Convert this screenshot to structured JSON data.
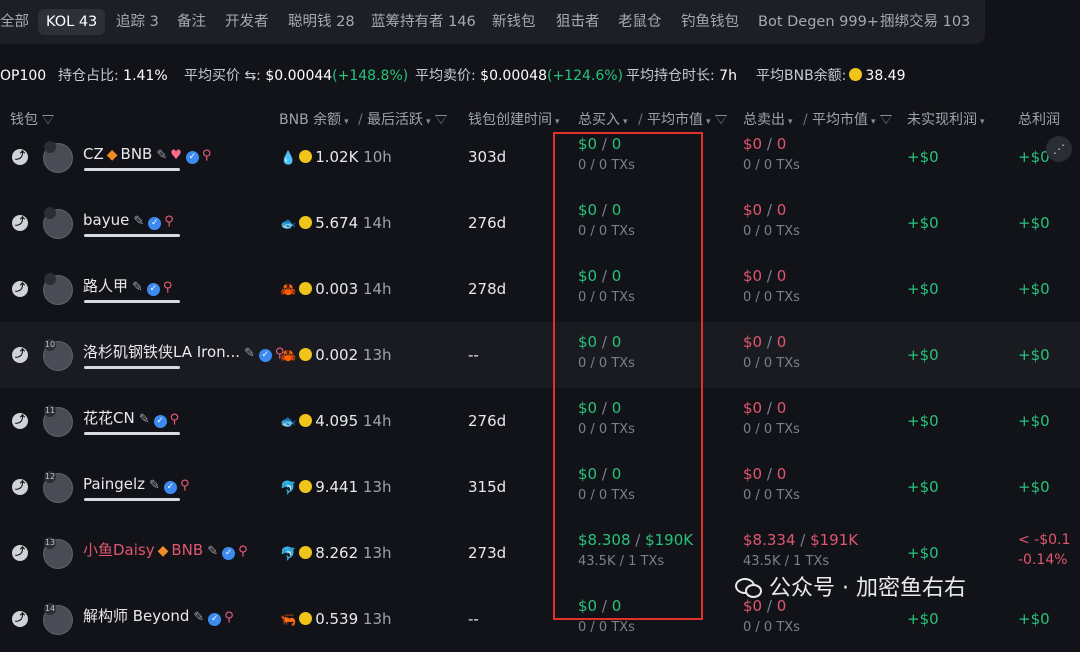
{
  "tabs": [
    {
      "label": "全部"
    },
    {
      "label": "KOL 43",
      "active": true
    },
    {
      "label": "追踪 3"
    },
    {
      "label": "备注"
    },
    {
      "label": "开发者"
    },
    {
      "label": "聪明钱 28"
    },
    {
      "label": "蓝筹持有者 146"
    },
    {
      "label": "新钱包"
    },
    {
      "label": "狙击者"
    },
    {
      "label": "老鼠仓"
    },
    {
      "label": "钓鱼钱包"
    },
    {
      "label": "Bot Degen 999+"
    },
    {
      "label": "捆绑交易 103"
    }
  ],
  "stats": {
    "top_label": "OP100",
    "hold_ratio_label": "持仓占比:",
    "hold_ratio_value": "1.41%",
    "avg_buy_label": "平均买价 ⇆:",
    "avg_buy_value": "$0.00044",
    "avg_buy_change": "(+148.8%)",
    "avg_sell_label": "平均卖价:",
    "avg_sell_value": "$0.00048",
    "avg_sell_change": "(+124.6%)",
    "avg_hold_label": "平均持仓时长:",
    "avg_hold_value": "7h",
    "avg_bnb_label": "平均BNB余额:",
    "avg_bnb_value": "38.49"
  },
  "columns": {
    "wallet": "钱包",
    "bnb_balance": "BNB 余额",
    "last_active": "最后活跃",
    "wallet_created": "钱包创建时间",
    "total_buy": "总买入",
    "avg_mcap_buy": "平均市值",
    "total_sell": "总卖出",
    "avg_mcap_sell": "平均市值",
    "unrealized": "未实现利润",
    "total_profit": "总利润"
  },
  "rows": [
    {
      "rank": "",
      "name": "CZ",
      "suffix": "BNB",
      "diamond": true,
      "heart": true,
      "underline": true,
      "red_name": false,
      "tag_icon": "water-drop",
      "bnb": "1.02K",
      "active": "10h",
      "created": "303d",
      "buy_amount": "$0",
      "buy_mcap": "0",
      "buy_sub": "0 / 0 TXs",
      "sell_amount": "$0",
      "sell_mcap": "0",
      "sell_sub": "0 / 0 TXs",
      "unrealized": "+$0",
      "profit": "+$0",
      "profit_sub": ""
    },
    {
      "rank": "",
      "name": "bayue",
      "suffix": "",
      "diamond": false,
      "heart": false,
      "underline": true,
      "red_name": false,
      "tag_icon": "fish",
      "bnb": "5.674",
      "active": "14h",
      "created": "276d",
      "buy_amount": "$0",
      "buy_mcap": "0",
      "buy_sub": "0 / 0 TXs",
      "sell_amount": "$0",
      "sell_mcap": "0",
      "sell_sub": "0 / 0 TXs",
      "unrealized": "+$0",
      "profit": "+$0",
      "profit_sub": ""
    },
    {
      "rank": "",
      "name": "路人甲",
      "suffix": "",
      "diamond": false,
      "heart": false,
      "underline": true,
      "red_name": false,
      "tag_icon": "crab",
      "bnb": "0.003",
      "active": "14h",
      "created": "278d",
      "buy_amount": "$0",
      "buy_mcap": "0",
      "buy_sub": "0 / 0 TXs",
      "sell_amount": "$0",
      "sell_mcap": "0",
      "sell_sub": "0 / 0 TXs",
      "unrealized": "+$0",
      "profit": "+$0",
      "profit_sub": ""
    },
    {
      "rank": "10",
      "name": "洛杉矶钢铁侠LA Iron...",
      "suffix": "",
      "diamond": false,
      "heart": false,
      "underline": true,
      "red_name": false,
      "tag_icon": "crab",
      "bnb": "0.002",
      "active": "13h",
      "created": "--",
      "buy_amount": "$0",
      "buy_mcap": "0",
      "buy_sub": "0 / 0 TXs",
      "sell_amount": "$0",
      "sell_mcap": "0",
      "sell_sub": "0 / 0 TXs",
      "unrealized": "+$0",
      "profit": "+$0",
      "profit_sub": ""
    },
    {
      "rank": "11",
      "name": "花花CN",
      "suffix": "",
      "diamond": false,
      "heart": false,
      "underline": true,
      "red_name": false,
      "tag_icon": "fish",
      "bnb": "4.095",
      "active": "14h",
      "created": "276d",
      "buy_amount": "$0",
      "buy_mcap": "0",
      "buy_sub": "0 / 0 TXs",
      "sell_amount": "$0",
      "sell_mcap": "0",
      "sell_sub": "0 / 0 TXs",
      "unrealized": "+$0",
      "profit": "+$0",
      "profit_sub": ""
    },
    {
      "rank": "12",
      "name": "Paingelz",
      "suffix": "",
      "diamond": false,
      "heart": false,
      "underline": true,
      "red_name": false,
      "tag_icon": "dolphin",
      "bnb": "9.441",
      "active": "13h",
      "created": "315d",
      "buy_amount": "$0",
      "buy_mcap": "0",
      "buy_sub": "0 / 0 TXs",
      "sell_amount": "$0",
      "sell_mcap": "0",
      "sell_sub": "0 / 0 TXs",
      "unrealized": "+$0",
      "profit": "+$0",
      "profit_sub": ""
    },
    {
      "rank": "13",
      "name": "小鱼Daisy",
      "suffix": "BNB",
      "diamond": true,
      "heart": false,
      "underline": false,
      "red_name": true,
      "tag_icon": "dolphin",
      "bnb": "8.262",
      "active": "13h",
      "created": "273d",
      "buy_amount": "$8.308",
      "buy_mcap": "$190K",
      "buy_sub": "43.5K / 1 TXs",
      "sell_amount": "$8.334",
      "sell_mcap": "$191K",
      "sell_sub": "43.5K / 1 TXs",
      "unrealized": "+$0",
      "profit": "< -$0.1",
      "profit_sub": "-0.14%"
    },
    {
      "rank": "14",
      "name": "解构师 Beyond",
      "suffix": "",
      "diamond": false,
      "heart": false,
      "underline": false,
      "red_name": false,
      "tag_icon": "shrimp",
      "bnb": "0.539",
      "active": "13h",
      "created": "--",
      "buy_amount": "$0",
      "buy_mcap": "0",
      "buy_sub": "0 / 0 TXs",
      "sell_amount": "$0",
      "sell_mcap": "0",
      "sell_sub": "0 / 0 TXs",
      "unrealized": "+$0",
      "profit": "+$0",
      "profit_sub": ""
    }
  ],
  "watermark": "公众号 · 加密鱼右右",
  "colors": {
    "green": "#27c27a",
    "red": "#e0566f",
    "highlight": "#e2302a",
    "background": "#121318"
  }
}
